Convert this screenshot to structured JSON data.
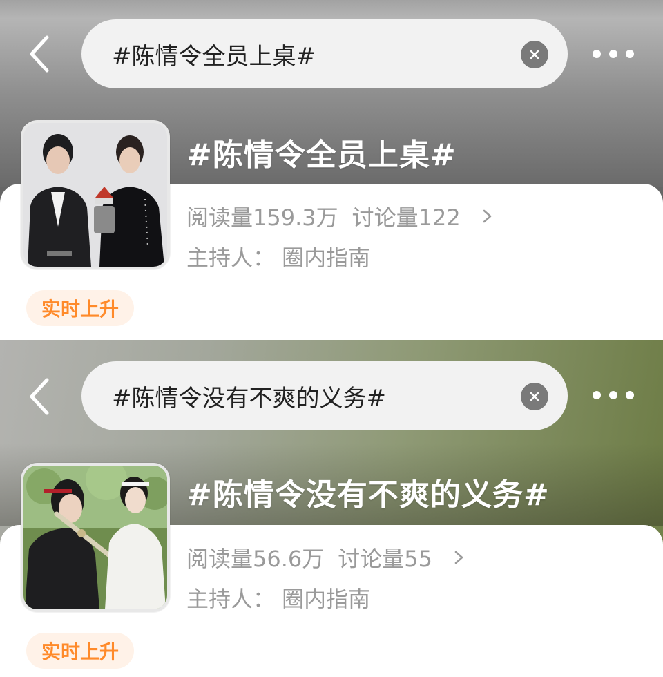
{
  "entries": [
    {
      "search_query": "#陈情令全员上桌#",
      "topic_title": "#陈情令全员上桌#",
      "reads": "阅读量159.3万",
      "discussions": "讨论量122",
      "host": "主持人：  圈内指南",
      "badge": "实时上升"
    },
    {
      "search_query": "#陈情令没有不爽的义务#",
      "topic_title": "#陈情令没有不爽的义务#",
      "reads": "阅读量56.6万",
      "discussions": "讨论量55",
      "host": "主持人：  圈内指南",
      "badge": "实时上升"
    }
  ],
  "icons": {
    "back": "chevron-left-icon",
    "clear": "close-circle-icon",
    "more": "more-dots-icon",
    "stats_arrow": "chevron-right-icon"
  },
  "colors": {
    "badge_text": "#ff8a2a",
    "badge_bg": "#fff2e8",
    "stats_text": "#9a9a9a"
  }
}
